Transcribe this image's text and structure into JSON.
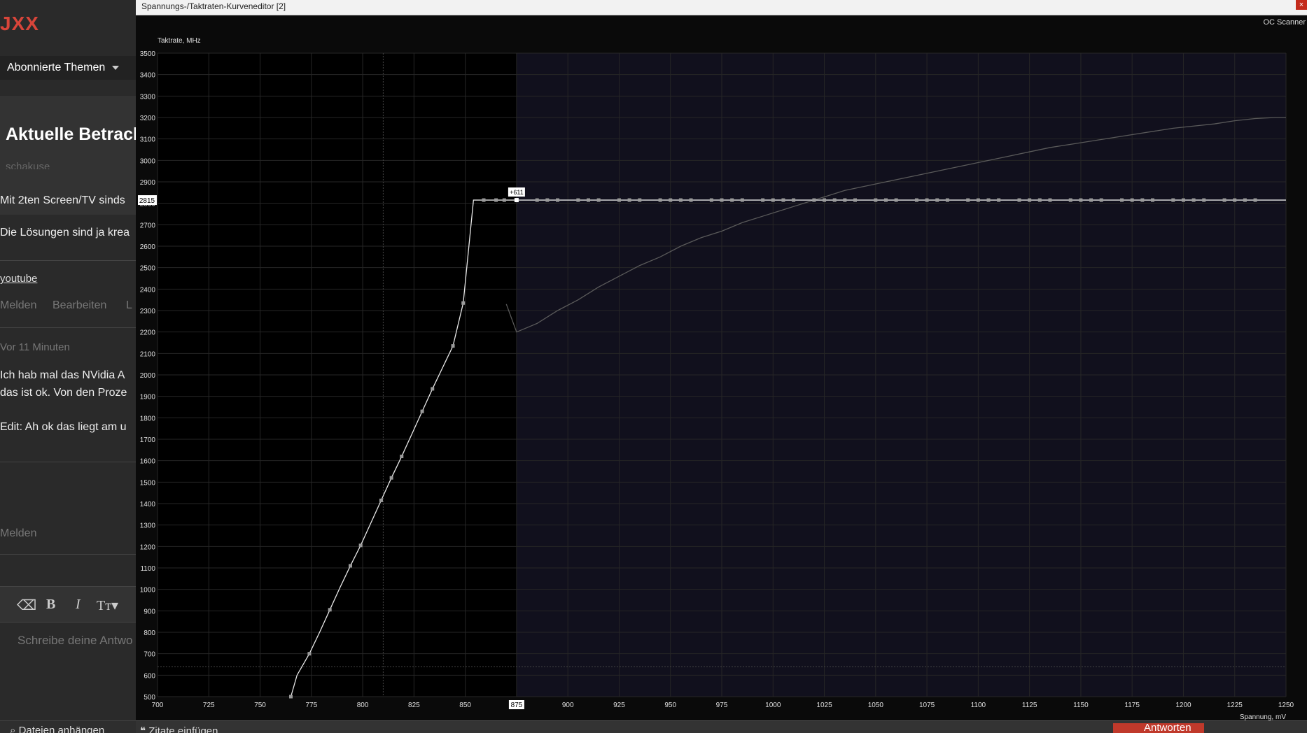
{
  "forum": {
    "logo": "JXX",
    "nav_label": "Abonnierte Themen",
    "thread_title": "Aktuelle Betrach",
    "author": "schakuse",
    "post1_line1": "Mit 2ten Screen/TV sinds",
    "post1_line2": "Die Lösungen sind ja krea",
    "link": "youtube",
    "action_report": "Melden",
    "action_edit": "Bearbeiten",
    "action_more": "L",
    "timestamp": "Vor 11 Minuten",
    "post2_line1": "Ich hab mal das NVidia A",
    "post2_line2": "das ist ok. Von den Proze",
    "post2_line3": "Edit: Ah ok das liegt am u",
    "action_report2": "Melden",
    "editor_placeholder": "Schreibe deine Antwo",
    "attach_label": "Dateien anhängen",
    "icons": [
      "eraser-icon",
      "bold-icon",
      "italic-icon",
      "text-size-icon",
      "paperclip-icon"
    ]
  },
  "editor": {
    "window_title": "Spannungs-/Taktraten-Kurveneditor [2]",
    "close": "×",
    "oc_scanner": "OC Scanner",
    "insert_quotes": "Zitate einfügen",
    "reply": "Antworten"
  },
  "chart_data": {
    "type": "line",
    "ylabel": "Taktrate, MHz",
    "xlabel": "Spannung, mV",
    "xlim": [
      700,
      1250
    ],
    "ylim": [
      500,
      3500
    ],
    "xticks": [
      700,
      725,
      750,
      775,
      800,
      825,
      850,
      875,
      900,
      925,
      950,
      975,
      1000,
      1025,
      1050,
      1075,
      1100,
      1125,
      1150,
      1175,
      1200,
      1225,
      1250
    ],
    "yticks": [
      500,
      600,
      700,
      800,
      900,
      1000,
      1100,
      1200,
      1300,
      1400,
      1500,
      1600,
      1700,
      1800,
      1900,
      2000,
      2100,
      2200,
      2300,
      2400,
      2500,
      2600,
      2700,
      2800,
      2900,
      3000,
      3100,
      3200,
      3300,
      3400,
      3500
    ],
    "selected_voltage": 875,
    "selected_clock": 2815,
    "offset_label": "+611",
    "active_limit_x": 875,
    "cursor_voltage": 810,
    "reference_clock": 640,
    "series": [
      {
        "role": "curve",
        "x": [
          765,
          768,
          774,
          779,
          784,
          789,
          794,
          799,
          804,
          809,
          814,
          819,
          824,
          829,
          834,
          839,
          844,
          849,
          854,
          859,
          864,
          869,
          875,
          880,
          885,
          890,
          895,
          900,
          905,
          910,
          915,
          920,
          925,
          930,
          935,
          940,
          945,
          950,
          955,
          960,
          965,
          970,
          975,
          980,
          985,
          990,
          995,
          1000,
          1005,
          1010,
          1015,
          1020,
          1025,
          1030,
          1035,
          1040,
          1045,
          1050,
          1055,
          1060,
          1065,
          1070,
          1075,
          1080,
          1085,
          1090,
          1095,
          1100,
          1105,
          1110,
          1115,
          1120,
          1125,
          1130,
          1135,
          1140,
          1145,
          1150,
          1155,
          1160,
          1165,
          1170,
          1175,
          1180,
          1185,
          1190,
          1195,
          1200,
          1205,
          1210,
          1215,
          1220,
          1225,
          1230,
          1235,
          1240,
          1250
        ],
        "y": [
          500,
          600,
          700,
          800,
          905,
          1010,
          1110,
          1205,
          1310,
          1415,
          1520,
          1620,
          1725,
          1830,
          1935,
          2035,
          2135,
          2335,
          2815,
          2815,
          2815,
          2815,
          2815,
          2815,
          2815,
          2815,
          2815,
          2815,
          2815,
          2815,
          2815,
          2815,
          2815,
          2815,
          2815,
          2815,
          2815,
          2815,
          2815,
          2815,
          2815,
          2815,
          2815,
          2815,
          2815,
          2815,
          2815,
          2815,
          2815,
          2815,
          2815,
          2815,
          2815,
          2815,
          2815,
          2815,
          2815,
          2815,
          2815,
          2815,
          2815,
          2815,
          2815,
          2815,
          2815,
          2815,
          2815,
          2815,
          2815,
          2815,
          2815,
          2815,
          2815,
          2815,
          2815,
          2815,
          2815,
          2815,
          2815,
          2815,
          2815,
          2815,
          2815,
          2815,
          2815,
          2815,
          2815,
          2815,
          2815,
          2815,
          2815,
          2815,
          2815,
          2815,
          2815,
          2815,
          2815
        ]
      },
      {
        "role": "default-curve",
        "x": [
          870,
          875,
          885,
          895,
          905,
          915,
          925,
          935,
          945,
          955,
          965,
          975,
          985,
          995,
          1005,
          1015,
          1025,
          1035,
          1045,
          1055,
          1065,
          1075,
          1085,
          1095,
          1105,
          1115,
          1125,
          1135,
          1145,
          1155,
          1165,
          1175,
          1185,
          1195,
          1205,
          1215,
          1225,
          1235,
          1245,
          1250
        ],
        "y": [
          2330,
          2200,
          2240,
          2300,
          2350,
          2410,
          2460,
          2510,
          2550,
          2600,
          2640,
          2670,
          2710,
          2740,
          2770,
          2800,
          2830,
          2860,
          2880,
          2900,
          2920,
          2940,
          2960,
          2980,
          3000,
          3020,
          3040,
          3060,
          3075,
          3090,
          3105,
          3120,
          3135,
          3150,
          3160,
          3170,
          3185,
          3195,
          3200,
          3200
        ]
      }
    ],
    "point_voltages_left": [
      765,
      774,
      784,
      794,
      799,
      809,
      814,
      819,
      829,
      834,
      844,
      849,
      859,
      865,
      869
    ],
    "point_voltages_flat": [
      885,
      890,
      895,
      905,
      910,
      915,
      925,
      930,
      935,
      945,
      950,
      955,
      960,
      970,
      975,
      980,
      985,
      995,
      1000,
      1005,
      1010,
      1020,
      1025,
      1030,
      1035,
      1040,
      1050,
      1055,
      1060,
      1070,
      1075,
      1080,
      1085,
      1095,
      1100,
      1105,
      1110,
      1120,
      1125,
      1130,
      1135,
      1145,
      1150,
      1155,
      1160,
      1170,
      1175,
      1180,
      1185,
      1195,
      1200,
      1205,
      1210,
      1220,
      1225,
      1230,
      1235
    ]
  }
}
